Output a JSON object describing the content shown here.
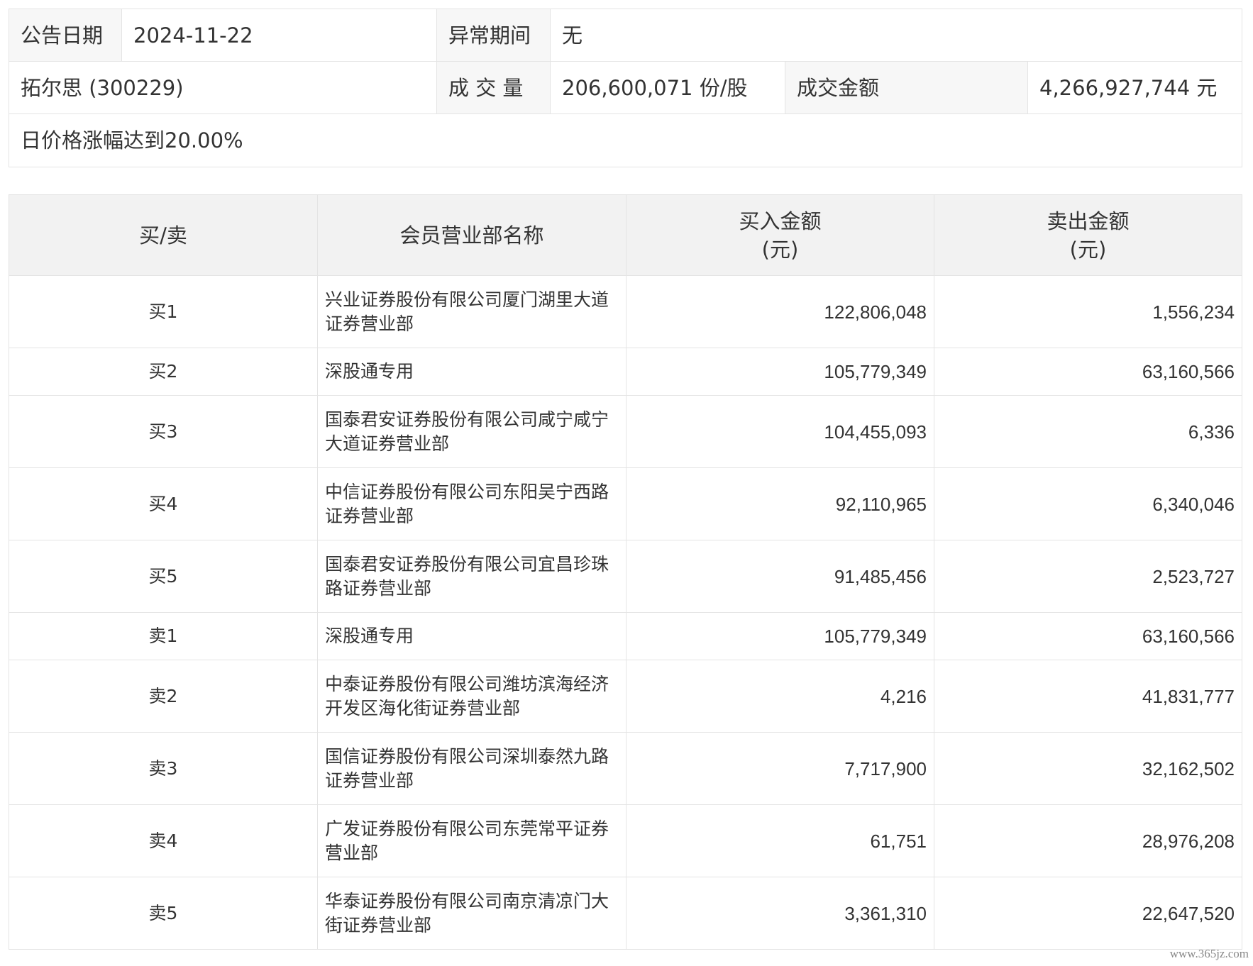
{
  "summary": {
    "announce_date_label": "公告日期",
    "announce_date": "2024-11-22",
    "abnormal_period_label": "异常期间",
    "abnormal_period": "无",
    "stock": "拓尔思 (300229)",
    "volume_label": "成 交 量",
    "volume": "206,600,071 份/股",
    "turnover_label": "成交金额",
    "turnover": "4,266,927,744 元",
    "reason": "日价格涨幅达到20.00%"
  },
  "table": {
    "headers": {
      "side": "买/卖",
      "name": "会员营业部名称",
      "buy": "买入金额",
      "buy_unit": "(元)",
      "sell": "卖出金额",
      "sell_unit": "(元)"
    },
    "rows": [
      {
        "side": "买1",
        "name": "兴业证券股份有限公司厦门湖里大道证券营业部",
        "buy": "122,806,048",
        "sell": "1,556,234"
      },
      {
        "side": "买2",
        "name": "深股通专用",
        "buy": "105,779,349",
        "sell": "63,160,566"
      },
      {
        "side": "买3",
        "name": "国泰君安证券股份有限公司咸宁咸宁大道证券营业部",
        "buy": "104,455,093",
        "sell": "6,336"
      },
      {
        "side": "买4",
        "name": "中信证券股份有限公司东阳吴宁西路证券营业部",
        "buy": "92,110,965",
        "sell": "6,340,046"
      },
      {
        "side": "买5",
        "name": "国泰君安证券股份有限公司宜昌珍珠路证券营业部",
        "buy": "91,485,456",
        "sell": "2,523,727"
      },
      {
        "side": "卖1",
        "name": "深股通专用",
        "buy": "105,779,349",
        "sell": "63,160,566"
      },
      {
        "side": "卖2",
        "name": "中泰证券股份有限公司潍坊滨海经济开发区海化街证券营业部",
        "buy": "4,216",
        "sell": "41,831,777"
      },
      {
        "side": "卖3",
        "name": "国信证券股份有限公司深圳泰然九路证券营业部",
        "buy": "7,717,900",
        "sell": "32,162,502"
      },
      {
        "side": "卖4",
        "name": "广发证券股份有限公司东莞常平证券营业部",
        "buy": "61,751",
        "sell": "28,976,208"
      },
      {
        "side": "卖5",
        "name": "华泰证券股份有限公司南京清凉门大街证券营业部",
        "buy": "3,361,310",
        "sell": "22,647,520"
      }
    ]
  },
  "watermark": "www.365jz.com"
}
